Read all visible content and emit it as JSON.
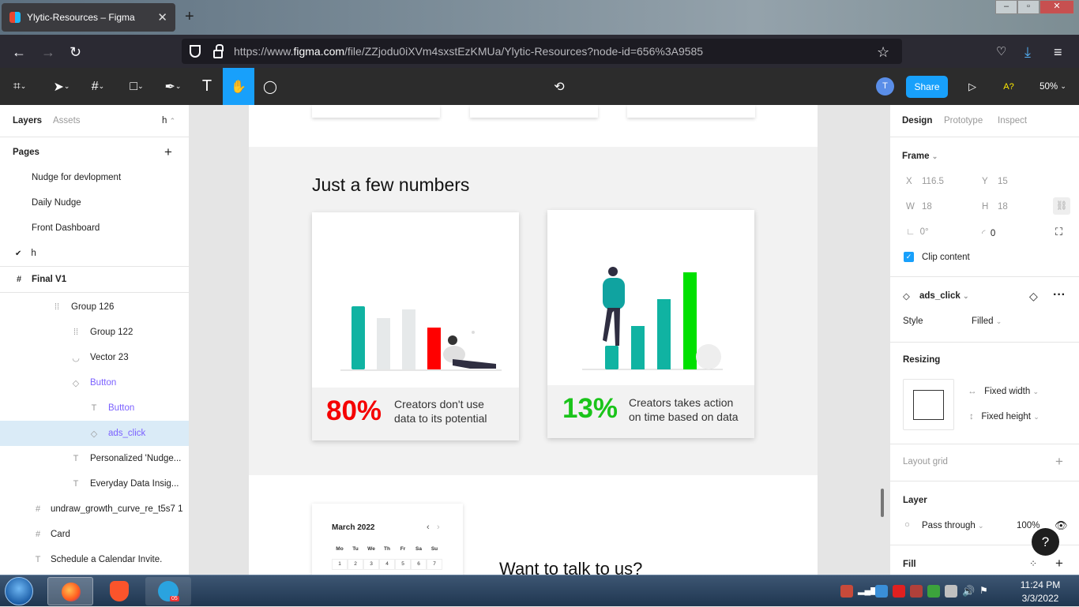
{
  "browser": {
    "tab_title": "Ylytic-Resources – Figma",
    "url_prefix": "https://www.",
    "url_domain": "figma.com",
    "url_rest": "/file/ZZjodu0iXVm4sxstEzKMUa/Ylytic-Resources?node-id=656%3A9585"
  },
  "toolbar": {
    "avatar": "T",
    "share_label": "Share",
    "accessibility": "A?",
    "zoom": "50%"
  },
  "left_panel": {
    "tab_layers": "Layers",
    "tab_assets": "Assets",
    "page_name": "h",
    "pages_heading": "Pages",
    "pages": [
      "Nudge for devlopment",
      "Daily Nudge",
      "Front Dashboard",
      "h"
    ],
    "frame_name": "Final V1",
    "layers": [
      {
        "name": "Group 126"
      },
      {
        "name": "Group 122"
      },
      {
        "name": "Vector 23"
      },
      {
        "name": "Button"
      },
      {
        "name": "Button"
      },
      {
        "name": "ads_click"
      },
      {
        "name": "Personalized 'Nudge..."
      },
      {
        "name": "Everyday Data Insig..."
      },
      {
        "name": "undraw_growth_curve_re_t5s7 1"
      },
      {
        "name": "Card"
      },
      {
        "name": "Schedule a Calendar Invite."
      }
    ]
  },
  "canvas": {
    "heading": "Just a few numbers",
    "stat1": {
      "value": "80%",
      "text_line1": "Creators don't use",
      "text_line2": "data to its potential",
      "color": "#f50000"
    },
    "stat2": {
      "value": "13%",
      "text_line1": "Creators takes action",
      "text_line2": "on time based on data",
      "color": "#1ac41a"
    },
    "calendar": {
      "month": "March 2022",
      "days": [
        "Mo",
        "Tu",
        "We",
        "Th",
        "Fr",
        "Sa",
        "Su"
      ],
      "dates": [
        "1",
        "2",
        "3",
        "4",
        "5",
        "6",
        "7"
      ]
    },
    "want_to_talk": "Want to talk to us?"
  },
  "right_panel": {
    "tab_design": "Design",
    "tab_prototype": "Prototype",
    "tab_inspect": "Inspect",
    "frame_label": "Frame",
    "x_label": "X",
    "x_value": "116.5",
    "y_label": "Y",
    "y_value": "15",
    "w_label": "W",
    "w_value": "18",
    "h_label": "H",
    "h_value": "18",
    "rotation": "0°",
    "radius": "0",
    "clip_content": "Clip content",
    "component_name": "ads_click",
    "style_label": "Style",
    "style_value": "Filled",
    "resizing": "Resizing",
    "fixed_width": "Fixed width",
    "fixed_height": "Fixed height",
    "layout_grid": "Layout grid",
    "layer": "Layer",
    "pass_through": "Pass through",
    "opacity": "100%",
    "fill": "Fill"
  },
  "help": "?",
  "taskbar": {
    "time": "11:24 PM",
    "date": "3/3/2022",
    "telegram_badge": "05"
  }
}
